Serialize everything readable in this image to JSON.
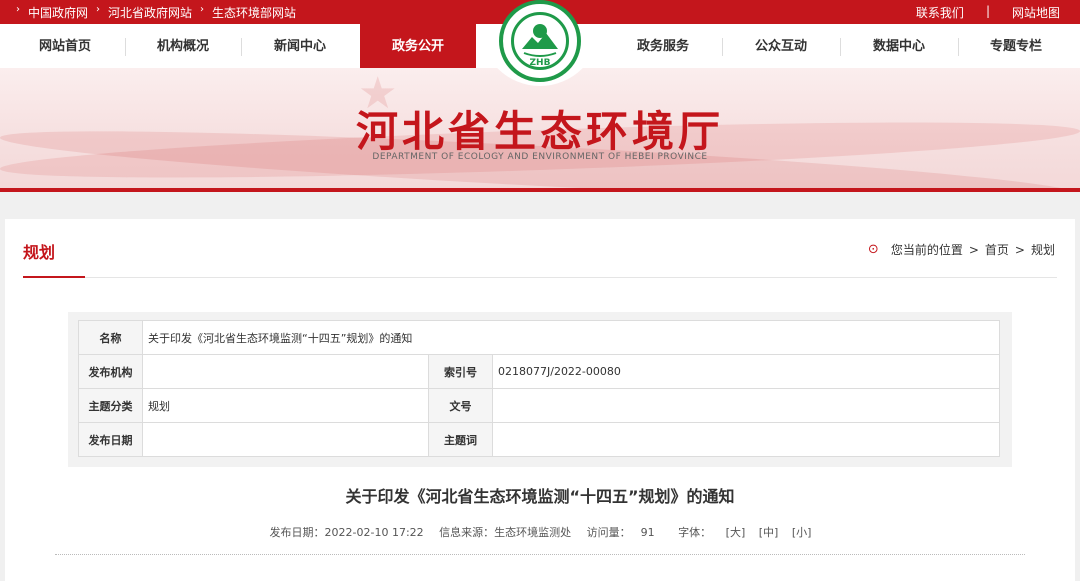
{
  "topbar": {
    "links": [
      "中国政府网",
      "河北省政府网站",
      "生态环境部网站"
    ],
    "right_links": [
      "联系我们",
      "网站地图"
    ],
    "separator": "|"
  },
  "nav": {
    "items": [
      "网站首页",
      "机构概况",
      "新闻中心",
      "政务公开",
      "政务服务",
      "公众互动",
      "数据中心",
      "专题专栏"
    ],
    "active": "政务公开"
  },
  "banner": {
    "title": "河北省生态环境厅",
    "subtitle": "DEPARTMENT OF ECOLOGY AND ENVIRONMENT OF HEBEI PROVINCE",
    "logo_text": "ZHB"
  },
  "section": {
    "heading": "规划",
    "breadcrumb": {
      "prefix": "您当前的位置",
      "items": [
        "首页",
        "规划"
      ],
      "sep": ">"
    }
  },
  "info_table": {
    "name_label": "名称",
    "name_value": "关于印发《河北省生态环境监测“十四五”规划》的通知",
    "org_label": "发布机构",
    "org_value": "",
    "index_label": "索引号",
    "index_value": "0218077J/2022-00080",
    "topic_label": "主题分类",
    "topic_value": "规划",
    "docno_label": "文号",
    "docno_value": "",
    "date_label": "发布日期",
    "date_value": "",
    "keyword_label": "主题词",
    "keyword_value": ""
  },
  "article": {
    "title": "关于印发《河北省生态环境监测“十四五”规划》的通知",
    "publish_label": "发布日期：",
    "publish_value": "2022-02-10 17:22",
    "source_label": "信息来源：",
    "source_value": "生态环境监测处",
    "views_label": "访问量：",
    "views_value": "91",
    "font_label": "字体：",
    "font_large": "[大]",
    "font_medium": "[中]",
    "font_small": "[小]"
  },
  "colors": {
    "brand_red": "#c4161c",
    "logo_green": "#1f9a49"
  }
}
